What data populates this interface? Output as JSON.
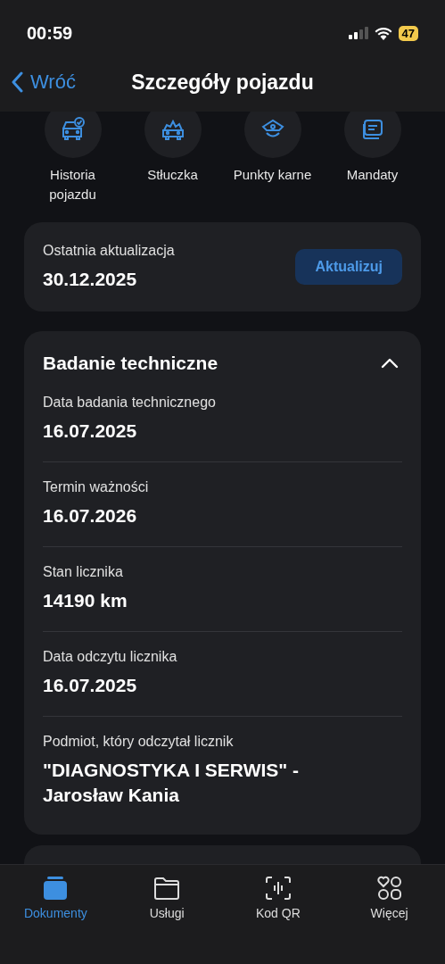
{
  "status_bar": {
    "time": "00:59",
    "battery": "47"
  },
  "nav": {
    "back": "Wróć",
    "title": "Szczegóły pojazdu"
  },
  "quick_actions": [
    {
      "kind": "history",
      "label": "Historia pojazdu"
    },
    {
      "kind": "collision",
      "label": "Stłuczka"
    },
    {
      "kind": "police",
      "label": "Punkty karne"
    },
    {
      "kind": "ticket",
      "label": "Mandaty"
    }
  ],
  "update_card": {
    "label": "Ostatnia aktualizacja",
    "value": "30.12.2025",
    "button": "Aktualizuj"
  },
  "inspection": {
    "title": "Badanie techniczne",
    "expanded": true,
    "fields": [
      {
        "label": "Data badania technicznego",
        "value": "16.07.2025"
      },
      {
        "label": "Termin ważności",
        "value": "16.07.2026"
      },
      {
        "label": "Stan licznika",
        "value": "14190 km"
      },
      {
        "label": "Data odczytu licznika",
        "value": "16.07.2025"
      },
      {
        "label": "Podmiot, który odczytał licznik",
        "value": "\"DIAGNOSTYKA I SERWIS\" - Jarosław Kania"
      }
    ]
  },
  "tab_bar": [
    {
      "kind": "documents",
      "label": "Dokumenty",
      "selected": true
    },
    {
      "kind": "services",
      "label": "Usługi",
      "selected": false
    },
    {
      "kind": "qr",
      "label": "Kod QR",
      "selected": false
    },
    {
      "kind": "more",
      "label": "Więcej",
      "selected": false
    }
  ]
}
